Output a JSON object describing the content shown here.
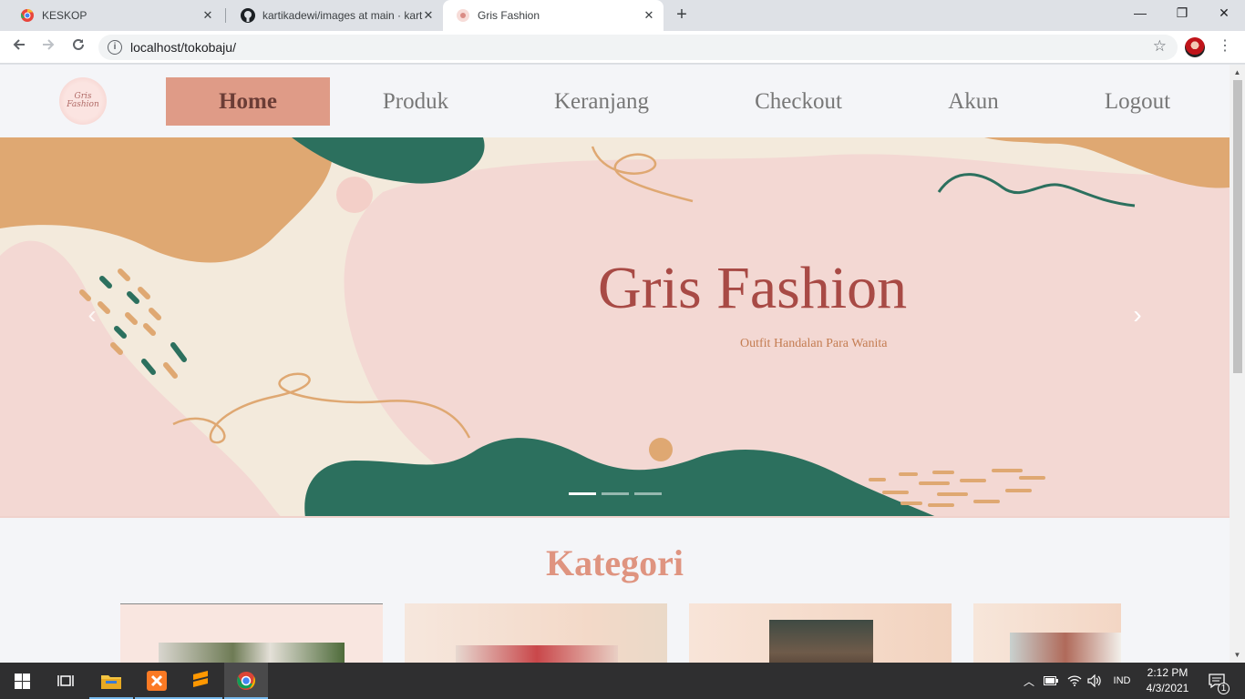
{
  "browser": {
    "tabs": [
      {
        "title": "KESKOP",
        "active": false
      },
      {
        "title": "kartikadewi/images at main · kart",
        "active": false
      },
      {
        "title": "Gris Fashion",
        "active": true
      }
    ],
    "new_tab": "+",
    "url": "localhost/tokobaju/",
    "window_controls": {
      "minimize": "—",
      "maximize": "❐",
      "close": "✕"
    }
  },
  "site": {
    "logo_line1": "Gris",
    "logo_line2": "Fashion",
    "nav": [
      {
        "label": "Home",
        "active": true
      },
      {
        "label": "Produk",
        "active": false
      },
      {
        "label": "Keranjang",
        "active": false
      },
      {
        "label": "Checkout",
        "active": false
      },
      {
        "label": "Akun",
        "active": false
      },
      {
        "label": "Logout",
        "active": false
      }
    ],
    "hero": {
      "title": "Gris Fashion",
      "subtitle": "Outfit Handalan Para Wanita",
      "prev": "‹",
      "next": "›",
      "slides": 3,
      "active_slide": 1
    },
    "section_title": "Kategori"
  },
  "taskbar": {
    "language": "IND",
    "time": "2:12 PM",
    "date": "4/3/2021",
    "notification_count": "1"
  },
  "colors": {
    "accent": "#df9b87",
    "hero_pink": "#f3d8d3",
    "hero_green": "#2c705e",
    "hero_tan": "#dfa872",
    "title_red": "#a84a45"
  }
}
